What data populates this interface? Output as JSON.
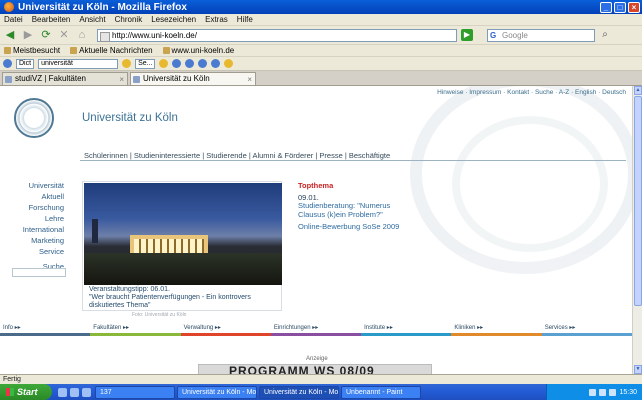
{
  "window": {
    "title": "Universität zu Köln - Mozilla Firefox",
    "buttons": {
      "minimize": "_",
      "maximize": "□",
      "close": "×"
    }
  },
  "menubar": [
    "Datei",
    "Bearbeiten",
    "Ansicht",
    "Chronik",
    "Lesezeichen",
    "Extras",
    "Hilfe"
  ],
  "navbar": {
    "url": "http://www.uni-koeln.de/",
    "search_placeholder": "Google",
    "back": "◀",
    "forward": "▶",
    "reload": "⟳",
    "stop": "✕",
    "home": "⌂",
    "go": "▶"
  },
  "bookmarks": [
    "Meistbesucht",
    "Aktuelle Nachrichten",
    "www.uni-koeln.de"
  ],
  "addonbar": {
    "select1": "Dict",
    "field": "universität",
    "select2": "Se..."
  },
  "tabs": [
    {
      "label": "studiVZ | Fakultäten",
      "active": false
    },
    {
      "label": "Universität zu Köln",
      "active": true
    }
  ],
  "page": {
    "toplinks": "Hinweise · Impressum · Kontakt · Suche · A-Z · English · Deutsch",
    "university_name": "Universität zu Köln",
    "mainnav": "Schülerinnen | Studieninteressierte | Studierende | Alumni & Förderer | Presse | Beschäftigte",
    "sidenav": [
      "Universität",
      "Aktuell",
      "Forschung",
      "Lehre",
      "International",
      "Marketing",
      "Service"
    ],
    "search_label": "Suche",
    "feature": {
      "caption_line1": "Veranstaltungstipp: 06.01.",
      "caption_line2": "\"Wer braucht Patientenverfügungen - Ein kontrovers diskutiertes Thema\"",
      "image_credit": "Foto: Universität zu Köln"
    },
    "topthema": {
      "heading": "Topthema",
      "date": "09.01.",
      "item1": "Studienberatung: \"Numerus Clausus (k)ein Problem?\"",
      "item2": "Online-Bewerbung SoSe 2009"
    },
    "colorbar": [
      {
        "label": "Info ▸▸",
        "color": "#4a6b8a"
      },
      {
        "label": "Fakultäten ▸▸",
        "color": "#8ab83a"
      },
      {
        "label": "Verwaltung ▸▸",
        "color": "#e0452b"
      },
      {
        "label": "Einrichtungen ▸▸",
        "color": "#8a4fa0"
      },
      {
        "label": "Institute ▸▸",
        "color": "#2a9ac8"
      },
      {
        "label": "Kliniken ▸▸",
        "color": "#e08a2b"
      },
      {
        "label": "Services ▸▸",
        "color": "#5aa0d0"
      }
    ],
    "promo_label": "Anzeige",
    "promo_text": "PROGRAMM WS 08/09"
  },
  "statusbar": "Fertig",
  "taskbar": {
    "start": "Start",
    "tasks": [
      "137",
      "Universität zu Köln - Mozilla Firefox",
      "Universität zu Köln - Mozilla Firefox",
      "Unbenannt - Paint"
    ],
    "clock": "15:30"
  }
}
